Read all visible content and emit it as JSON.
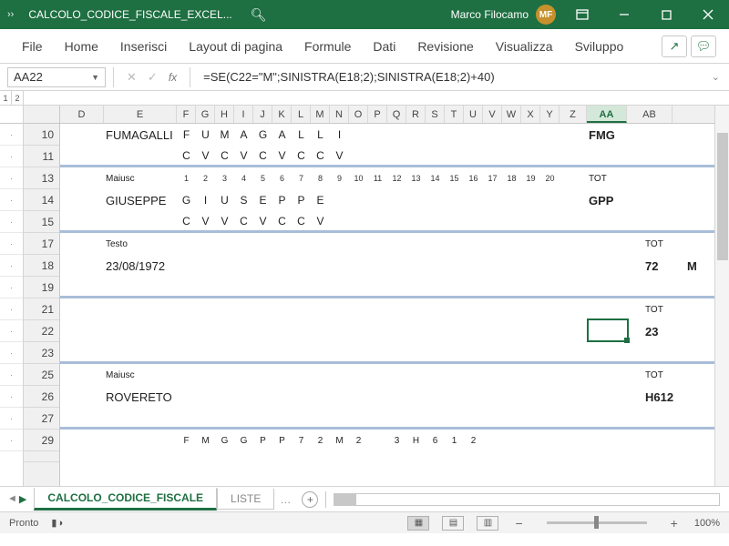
{
  "titlebar": {
    "title": "CALCOLO_CODICE_FISCALE_EXCEL...",
    "user_name": "Marco Filocamo",
    "avatar": "MF"
  },
  "ribbon": {
    "tabs": [
      "File",
      "Home",
      "Inserisci",
      "Layout di pagina",
      "Formule",
      "Dati",
      "Revisione",
      "Visualizza",
      "Sviluppo"
    ]
  },
  "fbar": {
    "cell_ref": "AA22",
    "fx_label": "fx",
    "formula": "=SE(C22=\"M\";SINISTRA(E18;2);SINISTRA(E18;2)+40)"
  },
  "columns": [
    "D",
    "E",
    "F",
    "G",
    "H",
    "I",
    "J",
    "K",
    "L",
    "M",
    "N",
    "O",
    "P",
    "Q",
    "R",
    "S",
    "T",
    "U",
    "V",
    "W",
    "X",
    "Y",
    "Z",
    "AA",
    "AB"
  ],
  "active_col": "AA",
  "row_labels": [
    "10",
    "11",
    "13",
    "14",
    "15",
    "17",
    "18",
    "19",
    "21",
    "22",
    "23",
    "25",
    "26",
    "27",
    "29"
  ],
  "grid": {
    "r10": {
      "E": "FUMAGALLI",
      "letters": [
        "F",
        "U",
        "M",
        "A",
        "G",
        "A",
        "L",
        "L",
        "I"
      ],
      "AA": "FMG"
    },
    "r11": {
      "cv": [
        "C",
        "V",
        "C",
        "V",
        "C",
        "V",
        "C",
        "C",
        "V"
      ]
    },
    "r13": {
      "E": "Maiusc",
      "nums": [
        "1",
        "2",
        "3",
        "4",
        "5",
        "6",
        "7",
        "8",
        "9",
        "10",
        "11",
        "12",
        "13",
        "14",
        "15",
        "16",
        "17",
        "18",
        "19",
        "20"
      ],
      "AA": "TOT"
    },
    "r14": {
      "E": "GIUSEPPE",
      "letters": [
        "G",
        "I",
        "U",
        "S",
        "E",
        "P",
        "P",
        "E"
      ],
      "AA": "GPP"
    },
    "r15": {
      "cv": [
        "C",
        "V",
        "V",
        "C",
        "V",
        "C",
        "C",
        "V"
      ]
    },
    "r17": {
      "E": "Testo",
      "AA": "TOT"
    },
    "r18": {
      "E": "23/08/1972",
      "AA": "72",
      "AB": "M"
    },
    "r21": {
      "AA": "TOT"
    },
    "r22": {
      "AA": "23"
    },
    "r25": {
      "E": "Maiusc",
      "AA": "TOT"
    },
    "r26": {
      "E": "ROVERETO",
      "AA": "H612"
    },
    "r29": {
      "letters": [
        "F",
        "M",
        "G",
        "G",
        "P",
        "P",
        "7",
        "2",
        "M",
        "2",
        "",
        "3",
        "H",
        "6",
        "1",
        "2"
      ]
    }
  },
  "sheets": {
    "active": "CALCOLO_CODICE_FISCALE",
    "other": "LISTE"
  },
  "status": {
    "text": "Pronto",
    "zoom": "100%"
  }
}
